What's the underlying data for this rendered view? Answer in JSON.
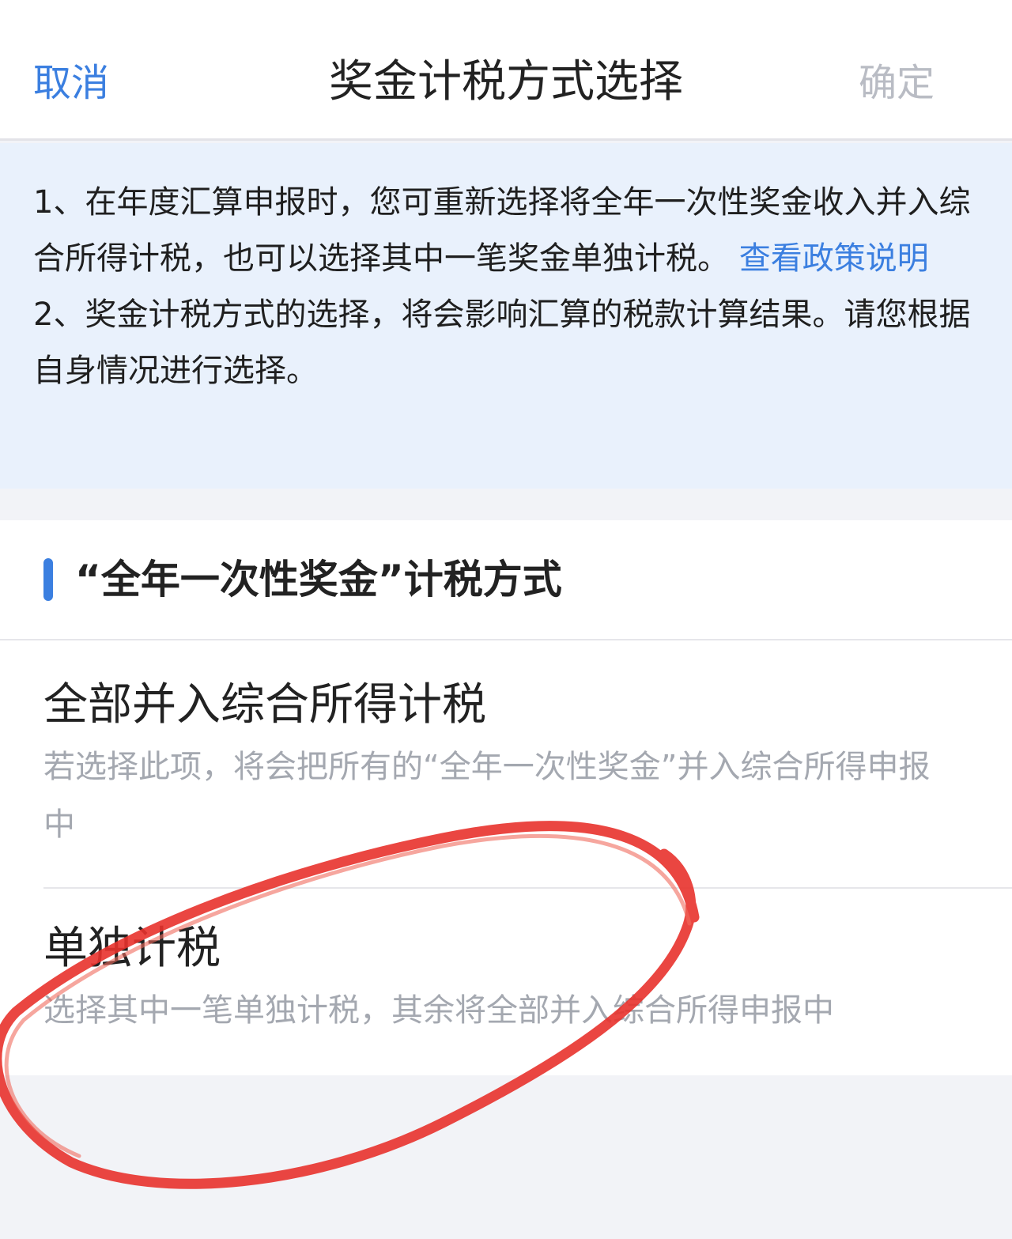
{
  "navbar": {
    "cancel_label": "取消",
    "title": "奖金计税方式选择",
    "confirm_label": "确定"
  },
  "notice": {
    "line1_text": "1、在年度汇算申报时，您可重新选择将全年一次性奖金收入并入综合所得计税，也可以选择其中一笔奖金单独计税。",
    "line1_link": "查看政策说明",
    "line2_text": "2、奖金计税方式的选择，将会影响汇算的税款计算结果。请您根据自身情况进行选择。"
  },
  "section": {
    "title": "“全年一次性奖金”计税方式"
  },
  "options": [
    {
      "title": "全部并入综合所得计税",
      "description": "若选择此项，将会把所有的“全年一次性奖金”并入综合所得申报中"
    },
    {
      "title": "单独计税",
      "description": "选择其中一笔单独计税，其余将全部并入综合所得申报中"
    }
  ],
  "colors": {
    "accent": "#3b7fe0",
    "notice_bg": "#e9f1fc",
    "annotation": "#e8322c"
  }
}
